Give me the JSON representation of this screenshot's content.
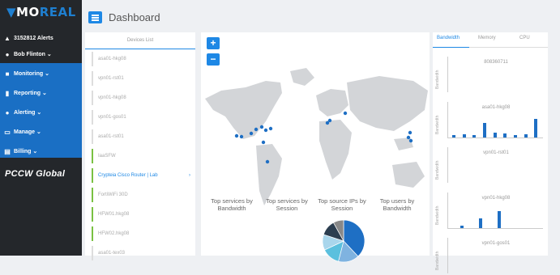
{
  "brand": {
    "logo_left": "MO",
    "logo_right": "REAL",
    "partner": "PCCW Global"
  },
  "sidebar": {
    "alerts": "3152812 Alerts",
    "user": "Bob Flinton ⌄",
    "items": [
      {
        "label": "Monitoring ⌄",
        "icon": "monitor-icon"
      },
      {
        "label": "Reporting ⌄",
        "icon": "chart-icon"
      },
      {
        "label": "Alerting ⌄",
        "icon": "bell-icon"
      },
      {
        "label": "Manage ⌄",
        "icon": "manage-icon"
      },
      {
        "label": "Billing ⌄",
        "icon": "billing-icon"
      }
    ]
  },
  "header": {
    "title": "Dashboard"
  },
  "devices": {
    "title": "Devices List",
    "items": [
      {
        "label": "asa01-hkg08",
        "status": "none"
      },
      {
        "label": "vpn01-rst01",
        "status": "none"
      },
      {
        "label": "vpn01-hkg08",
        "status": "none"
      },
      {
        "label": "vpn01-gos01",
        "status": "none"
      },
      {
        "label": "asa01-rst01",
        "status": "none"
      },
      {
        "label": "IaaSFW",
        "status": "green"
      },
      {
        "label": "Crypteia Cisco Router | Lab",
        "status": "green",
        "selected": true
      },
      {
        "label": "FortiWiFi 30D",
        "status": "green"
      },
      {
        "label": "HFW01.hkg08",
        "status": "green"
      },
      {
        "label": "HFW02.hkg08",
        "status": "green"
      },
      {
        "label": "asa01-tex03",
        "status": "none"
      }
    ]
  },
  "map": {
    "zoom_in": "+",
    "zoom_out": "−",
    "widgets": [
      "Top services by Bandwidth",
      "Top services by Session",
      "Top source IPs by Session",
      "Top users by Bandwidth"
    ],
    "pie_colors": [
      "#1e6fc4",
      "#7fb3e0",
      "#5bc0de",
      "#a9d6ec",
      "#2c3e50",
      "#888888"
    ]
  },
  "right_panel": {
    "tabs": [
      "Bandwidth",
      "Memory",
      "CPU"
    ],
    "active_tab": "Bandwidth",
    "y_label": "Bandwidth",
    "charts": [
      {
        "title": "808360711",
        "values": []
      },
      {
        "title": "asa01-hkg08",
        "values": [
          0.1,
          0.15,
          0.1,
          0.7,
          0.25,
          0.2,
          0.1,
          0.15,
          0.9
        ]
      },
      {
        "title": "vpn01-rst01",
        "values": []
      },
      {
        "title": "vpn01-hkg08",
        "values": [
          0.1,
          0.45,
          0.8
        ]
      },
      {
        "title": "vpn01-gos01",
        "values": []
      }
    ]
  },
  "colors": {
    "accent": "#1e88e5",
    "sidebar": "#24272b",
    "nav_active": "#1a6fc4",
    "status_ok": "#7ac142"
  }
}
